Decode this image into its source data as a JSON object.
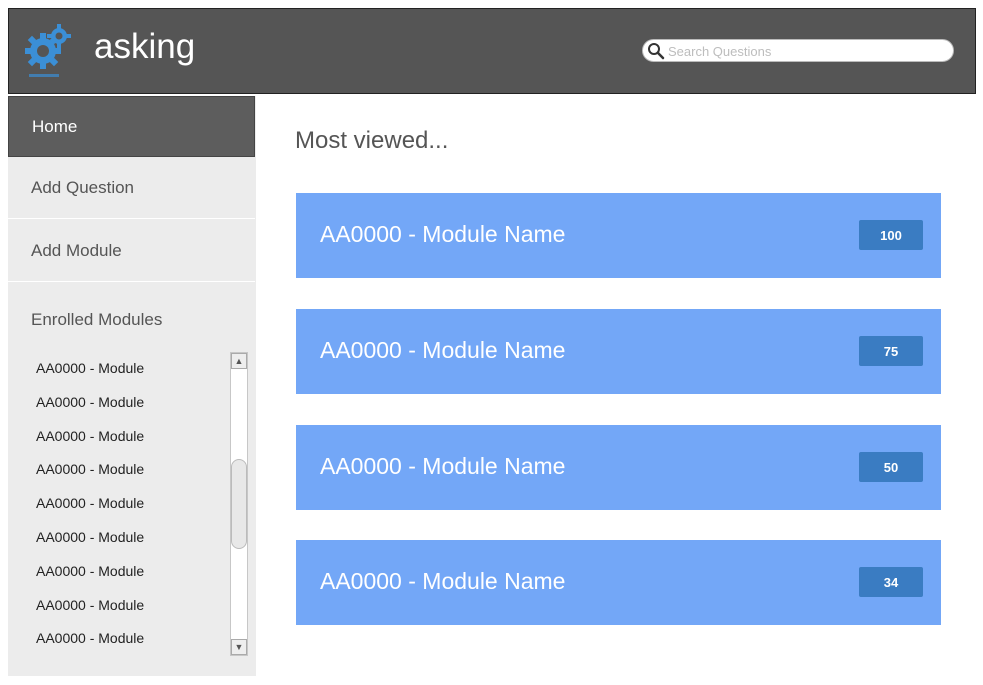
{
  "app": {
    "title": "asking"
  },
  "search": {
    "placeholder": "Search Questions",
    "value": ""
  },
  "nav": {
    "items": [
      {
        "label": "Home",
        "active": true
      },
      {
        "label": "Add Question",
        "active": false
      },
      {
        "label": "Add Module",
        "active": false
      }
    ],
    "enrolled_title": "Enrolled Modules",
    "enrolled": [
      "AA0000 - Module",
      "AA0000 - Module",
      "AA0000 - Module",
      "AA0000 - Module",
      "AA0000 - Module",
      "AA0000 - Module",
      "AA0000 - Module",
      "AA0000 - Module",
      "AA0000 - Module"
    ]
  },
  "main": {
    "title": "Most viewed...",
    "modules": [
      {
        "name": "AA0000 - Module Name",
        "count": "100"
      },
      {
        "name": "AA0000 - Module Name",
        "count": "75"
      },
      {
        "name": "AA0000 - Module Name",
        "count": "50"
      },
      {
        "name": "AA0000 - Module Name",
        "count": "34"
      }
    ]
  },
  "colors": {
    "header_bg": "#555555",
    "sidebar_bg": "#ececec",
    "active_nav_bg": "#5d5d5d",
    "card_bg": "#73a7f7",
    "badge_bg": "#3a7cc2",
    "logo": "#3b8fd6"
  },
  "icons": {
    "logo": "gears-icon",
    "search": "search-icon"
  }
}
